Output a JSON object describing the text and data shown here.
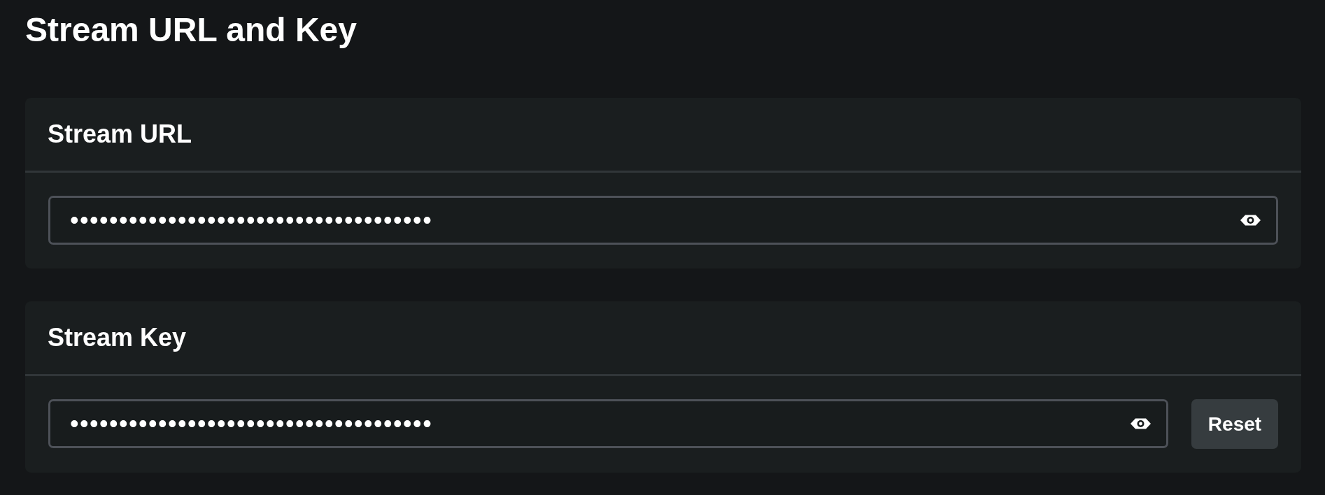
{
  "page": {
    "title": "Stream URL and Key"
  },
  "sections": [
    {
      "heading": "Stream URL",
      "field": {
        "value": "•••••••••••••••••••••••••••••••••••••"
      }
    },
    {
      "heading": "Stream Key",
      "field": {
        "value": "•••••••••••••••••••••••••••••••••••••"
      },
      "button": "Reset"
    }
  ]
}
